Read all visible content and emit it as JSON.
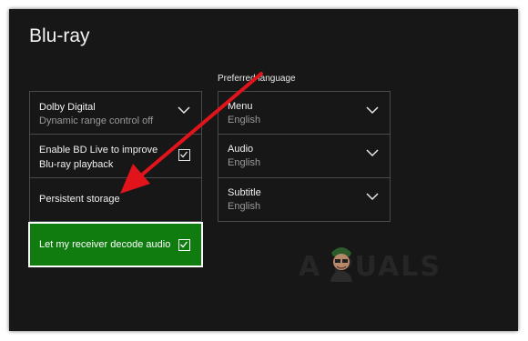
{
  "page": {
    "title": "Blu-ray"
  },
  "settings": [
    {
      "label": "Dolby Digital",
      "sub": "Dynamic range control off",
      "control": "chevron-down-icon"
    },
    {
      "label": "Enable BD Live to improve Blu-ray playback",
      "control": "checkbox",
      "checked": true
    },
    {
      "label": "Persistent storage"
    },
    {
      "label": "Let my receiver decode audio",
      "control": "checkbox",
      "checked": true,
      "focused": true
    }
  ],
  "preferred_language": {
    "heading": "Preferred language",
    "items": [
      {
        "label": "Menu",
        "value": "English",
        "control": "chevron-down-icon"
      },
      {
        "label": "Audio",
        "value": "English",
        "control": "chevron-down-icon"
      },
      {
        "label": "Subtitle",
        "value": "English",
        "control": "chevron-down-icon"
      }
    ]
  },
  "watermark": {
    "text": "A  PUALS"
  },
  "colors": {
    "background": "#171717",
    "focus_green": "#107c10",
    "annotation_arrow": "#e0141a"
  }
}
